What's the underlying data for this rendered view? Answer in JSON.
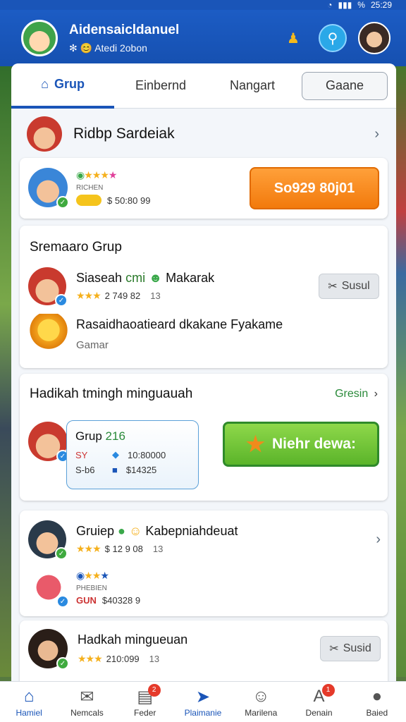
{
  "status": {
    "time": "25:29",
    "battery": "%"
  },
  "header": {
    "title": "Aidensaicldanuel",
    "subtitle": "Atedi 2obon",
    "sub_icons": "✻ 😊"
  },
  "tabs": [
    {
      "label": "Grup"
    },
    {
      "label": "Einbernd"
    },
    {
      "label": "Nangart"
    },
    {
      "label": "Gaane"
    }
  ],
  "group_header": {
    "title": "Ridbp Sardeiak"
  },
  "offer_card": {
    "sub_label": "RICHEN",
    "amount": "$ 50:80 99",
    "button": "So929 80j01"
  },
  "members_card": {
    "title": "Sremaaro Grup",
    "member1": {
      "name": "Siaseah",
      "tag": "cmi",
      "extra": "Makarak",
      "stats": "2 749 82",
      "count": "13",
      "button": "Susul"
    },
    "member2": {
      "name": "Rasaidhaoatieard dkakane Fyakame",
      "sub": "Gamar"
    }
  },
  "challenge_card": {
    "title": "Hadikah tmingh minguauah",
    "link": "Gresin",
    "bubble": {
      "title": "Grup",
      "count": "216",
      "l1": "SY",
      "v1": "10:80000",
      "l2": "S-b6",
      "v2": "$14325"
    },
    "button": "Niehr dewa:"
  },
  "group2_card": {
    "name": "Gruiep",
    "extra": "Kabepniahdeuat",
    "stats": "$ 12 9 08",
    "count": "13",
    "sub_label": "PHEBIEN",
    "tag": "GUN",
    "amount": "$40328 9"
  },
  "last_card": {
    "name": "Hadkah mingueuan",
    "stats": "210:099",
    "count": "13",
    "button": "Susid"
  },
  "nav": [
    {
      "label": "Hamiel",
      "icon": "⌂",
      "badge": ""
    },
    {
      "label": "Nemcals",
      "icon": "✉",
      "badge": ""
    },
    {
      "label": "Feder",
      "icon": "▤",
      "badge": "2"
    },
    {
      "label": "Plaimanie",
      "icon": "➤",
      "badge": ""
    },
    {
      "label": "Marilena",
      "icon": "☺",
      "badge": ""
    },
    {
      "label": "Denain",
      "icon": "A",
      "badge": "1"
    },
    {
      "label": "Baied",
      "icon": "●",
      "badge": ""
    }
  ]
}
